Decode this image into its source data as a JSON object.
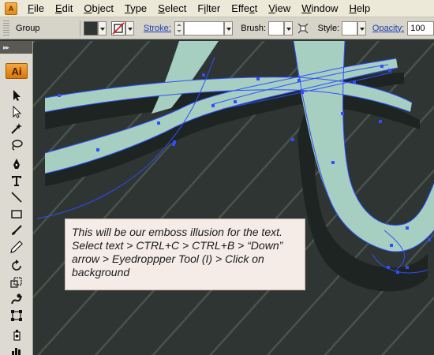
{
  "menubar": {
    "items": [
      "File",
      "Edit",
      "Object",
      "Type",
      "Select",
      "Filter",
      "Effect",
      "View",
      "Window",
      "Help"
    ],
    "mnemonics": [
      "F",
      "E",
      "O",
      "T",
      "S",
      "i",
      "c",
      "V",
      "W",
      "H"
    ]
  },
  "control_bar": {
    "selection_label": "Group",
    "fill_color": "#2e3532",
    "stroke_label": "Stroke:",
    "stroke_value": "",
    "brush_label": "Brush:",
    "style_label": "Style:",
    "opacity_label": "Opacity:",
    "opacity_value": "100"
  },
  "tools_panel": {
    "header_icon": "collapse-chevrons-icon",
    "app_badge": "Ai",
    "tools": [
      "selection-tool-icon",
      "direct-selection-tool-icon",
      "magic-wand-tool-icon",
      "lasso-tool-icon",
      "pen-tool-icon",
      "type-tool-icon",
      "line-segment-tool-icon",
      "rectangle-tool-icon",
      "paintbrush-tool-icon",
      "pencil-tool-icon",
      "rotate-tool-icon",
      "scale-tool-icon",
      "warp-tool-icon",
      "free-transform-tool-icon",
      "symbol-sprayer-tool-icon",
      "column-graph-tool-icon"
    ]
  },
  "canvas": {
    "background_color": "#2e3532",
    "stripe_color": "#4a524e",
    "letter_fill_color": "#a6cfc1",
    "shadow_color": "#1e2422",
    "path_color": "#2f4fff"
  },
  "note": {
    "text": "This will be our emboss illusion for the text. Select text > CTRL+C > CTRL+B > “Down” arrow > Eyedroppper Tool (I) > Click on background"
  }
}
